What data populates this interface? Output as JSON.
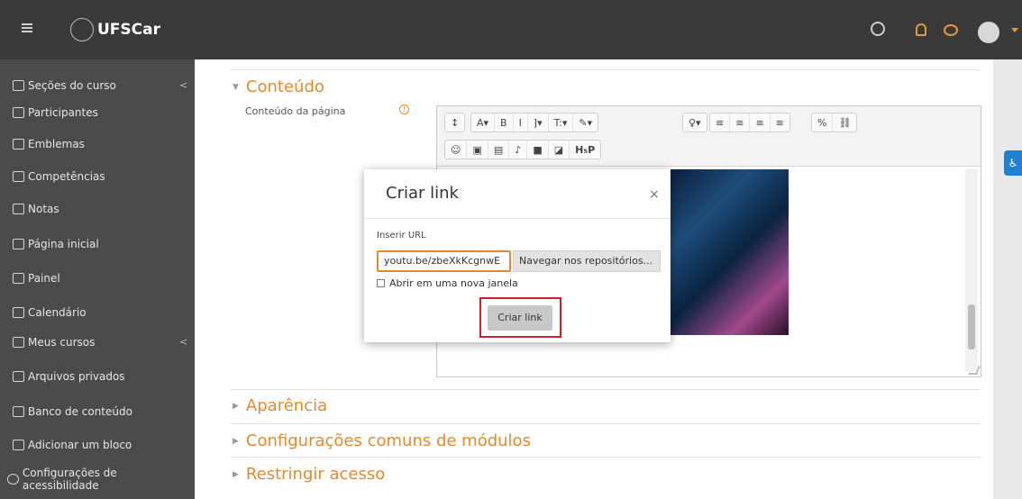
{
  "navbar": {
    "logo_text": "UFSCar",
    "colors": {
      "background": "#3a3a3a",
      "accent": "#e79a3c"
    }
  },
  "sidebar": {
    "items": [
      {
        "label": "Seções do curso",
        "icon": "list-icon",
        "has_chevron": true
      },
      {
        "label": "Participantes",
        "icon": "users-icon"
      },
      {
        "label": "Emblemas",
        "icon": "badge-icon"
      },
      {
        "label": "Competências",
        "icon": "star-icon"
      },
      {
        "label": "Notas",
        "icon": "grades-icon"
      },
      {
        "label": "Página inicial",
        "icon": "home-icon"
      },
      {
        "label": "Painel",
        "icon": "dashboard-icon"
      },
      {
        "label": "Calendário",
        "icon": "calendar-icon"
      },
      {
        "label": "Meus cursos",
        "icon": "graduation-cap-icon",
        "has_chevron": true
      },
      {
        "label": "Arquivos privados",
        "icon": "files-icon"
      },
      {
        "label": "Banco de conteúdo",
        "icon": "content-bank-icon"
      },
      {
        "label": "Adicionar um bloco",
        "icon": "add-block-icon"
      },
      {
        "label": "Configurações de acessibilidade",
        "icon": "accessibility-icon"
      }
    ],
    "chevron": "<"
  },
  "main": {
    "sections": {
      "conteudo": "Conteúdo",
      "aparencia": "Aparência",
      "configuracoes": "Configurações comuns de módulos",
      "restringir": "Restringir acesso"
    },
    "field_label": "Conteúdo da página",
    "required_mark": "!"
  },
  "editor": {
    "toolbar_row1": [
      "↕",
      "A▾",
      "B",
      "I",
      "⁆▾",
      "T:▾",
      "✎▾",
      "♀▾",
      "≡",
      "≡",
      "≡",
      "≡",
      "%",
      "⛓"
    ],
    "toolbar_row2": [
      "☺",
      "▣",
      "▤",
      "♪",
      "■",
      "◪",
      "H₅P"
    ]
  },
  "modal": {
    "title": "Criar link",
    "close": "×",
    "url_label": "Inserir URL",
    "url_value": "youtu.be/zbeXkKcgnwE",
    "browse_label": "Navegar nos repositórios...",
    "new_window_label": "Abrir em uma nova janela",
    "create_label": "Criar link",
    "highlight_colors": {
      "input": "#e48a2e",
      "button": "#c9242e"
    }
  }
}
